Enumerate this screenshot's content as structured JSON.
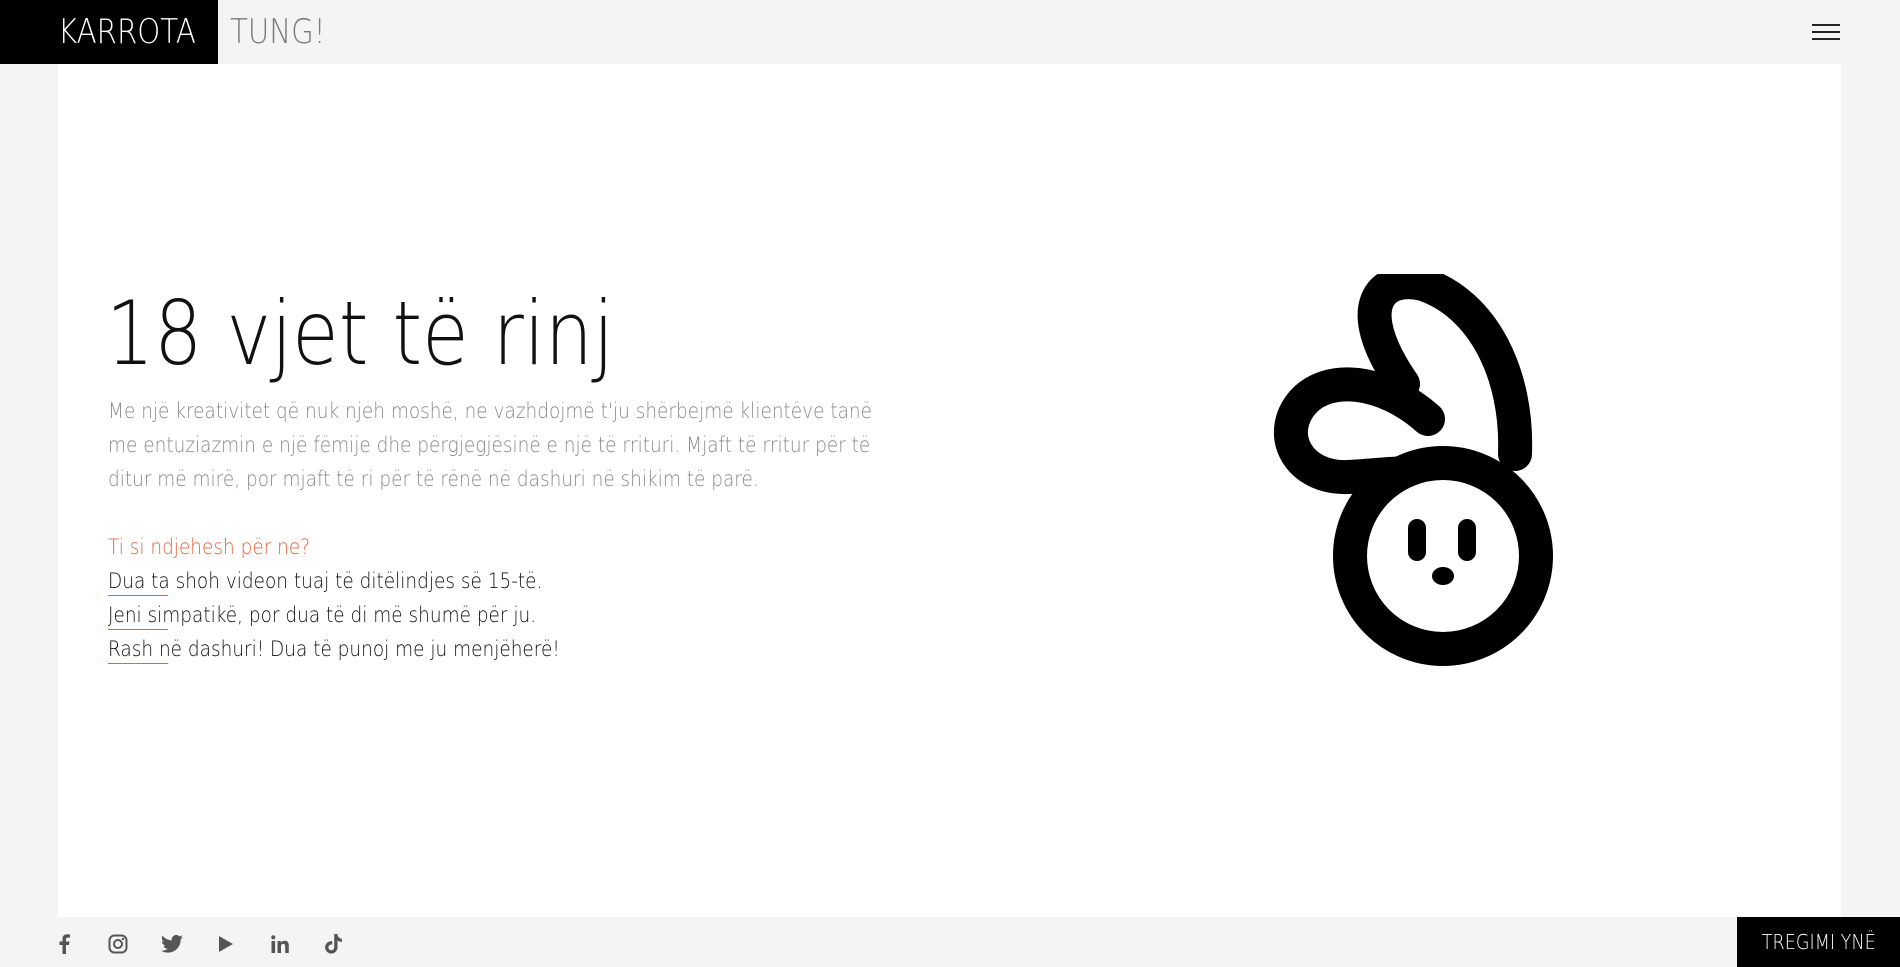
{
  "header": {
    "logo": "KARROTA",
    "tagline": "TUNG!",
    "menu_icon": "hamburger-menu-icon"
  },
  "main": {
    "headline": "18 vjet të rinj",
    "intro_lines": [
      "Me një kreativitet që nuk njeh moshë, ne vazhdojmë t'ju shërbejmë klientëve tanë",
      "me entuziazmin e një fëmije dhe përgjegjësinë e një të rrituri. Mjaft të rritur për të",
      "ditur më mirë, por mjaft të ri për të rënë në dashuri në shikim të parë."
    ],
    "question": "Ti si ndjehesh për ne?",
    "answers": [
      "Dua ta shoh videon tuaj të ditëlindjes së 15-të.",
      "Jeni simpatikë, por dua të di më shumë për ju.",
      "Rash në dashuri! Dua të punoj me ju menjëherë!"
    ],
    "illustration": "rabbit-logo-icon"
  },
  "footer": {
    "social_icons": [
      "facebook-icon",
      "instagram-icon",
      "twitter-icon",
      "youtube-icon",
      "linkedin-icon",
      "tiktok-icon"
    ],
    "story_button": "TREGIMI YNË"
  },
  "colors": {
    "accent": "#e8633a",
    "text": "#111111",
    "muted": "#8a8a8a",
    "background": "#f4f4f4",
    "panel": "#ffffff",
    "black": "#000000"
  }
}
